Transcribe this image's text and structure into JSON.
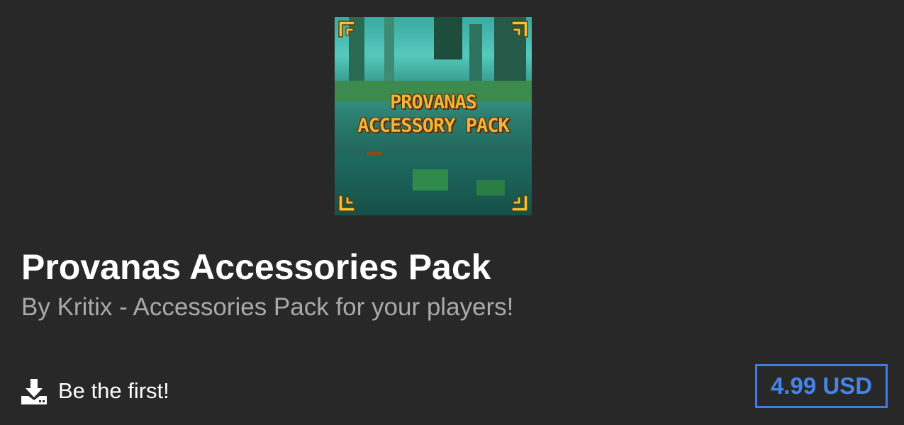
{
  "thumbnail": {
    "art_line_1": "PROVANAS",
    "art_line_2": "ACCESSORY PACK"
  },
  "product": {
    "title": "Provanas Accessories Pack",
    "subtitle": "By Kritix - Accessories Pack for your players!"
  },
  "downloads": {
    "icon": "download-icon",
    "label": "Be the first!"
  },
  "price": {
    "label": "4.99 USD",
    "accent_color": "#3f7de0"
  }
}
